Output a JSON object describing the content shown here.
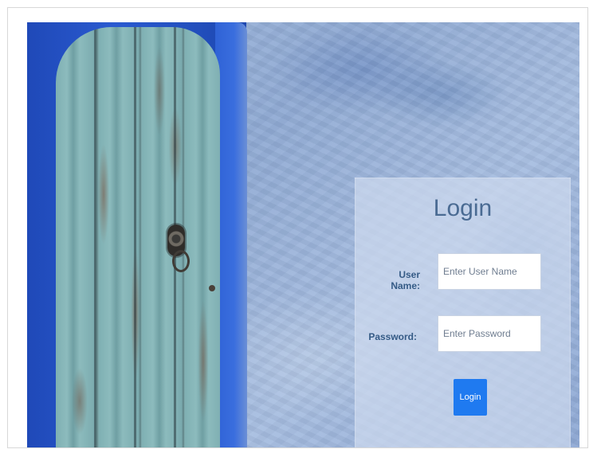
{
  "login": {
    "title": "Login",
    "username_label": "User Name:",
    "username_placeholder": "Enter User Name",
    "username_value": "",
    "password_label": "Password:",
    "password_placeholder": "Enter Password",
    "password_value": "",
    "submit_label": "Login"
  },
  "colors": {
    "wall": "#9fb7dc",
    "door_frame": "#1f49b8",
    "door": "#86b6b8",
    "panel": "#cddaee",
    "title_text": "#4a6b93",
    "label_text": "#355b86",
    "button": "#1f7af0"
  }
}
